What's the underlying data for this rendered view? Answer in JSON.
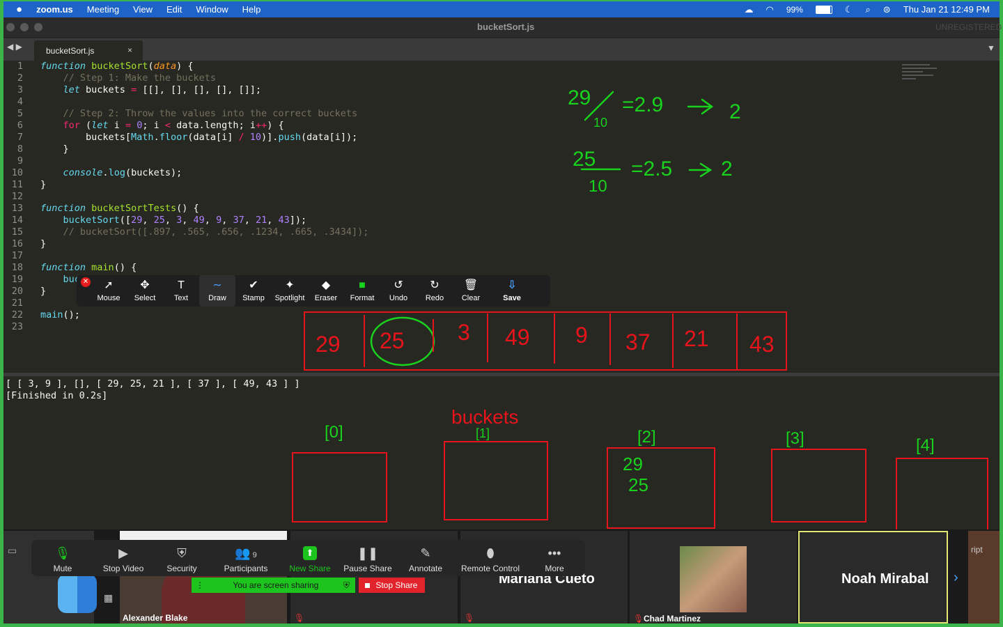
{
  "menubar": {
    "apple": "",
    "app": "zoom.us",
    "items": [
      "Meeting",
      "View",
      "Edit",
      "Window",
      "Help"
    ],
    "battery": "99%",
    "clock": "Thu Jan 21  12:49 PM"
  },
  "editor": {
    "title": "bucketSort.js",
    "status": "UNREGISTERED",
    "tab_label": "bucketSort.js",
    "tab_close": "×"
  },
  "code": [
    {
      "n": "1",
      "html": "<span class=\"kw\">function</span> <span class=\"fn\">bucketSort</span>(<span class=\"param\">data</span>) {"
    },
    {
      "n": "2",
      "html": "    <span class=\"cm\">// Step 1: Make the buckets</span>"
    },
    {
      "n": "3",
      "html": "    <span class=\"kw\">let</span> buckets <span class=\"op\">=</span> [[], [], [], [], []];"
    },
    {
      "n": "4",
      "html": ""
    },
    {
      "n": "5",
      "html": "    <span class=\"cm\">// Step 2: Throw the values into the correct buckets</span>"
    },
    {
      "n": "6",
      "html": "    <span class=\"op\">for</span> (<span class=\"kw\">let</span> i <span class=\"op\">=</span> <span class=\"num\">0</span>; i <span class=\"op\">&lt;</span> data.length; i<span class=\"op\">++</span>) {"
    },
    {
      "n": "7",
      "html": "        buckets[<span class=\"kw\" style=\"font-style:normal\">Math</span>.<span class=\"kw\" style=\"font-style:normal\">floor</span>(data[i] <span class=\"op\">/</span> <span class=\"num\">10</span>)].<span class=\"kw\" style=\"font-style:normal\">push</span>(data[i]);"
    },
    {
      "n": "8",
      "html": "    }"
    },
    {
      "n": "9",
      "html": ""
    },
    {
      "n": "10",
      "html": "    <span class=\"kw\">console</span>.<span class=\"kw\" style=\"font-style:normal\">log</span>(buckets);"
    },
    {
      "n": "11",
      "html": "}"
    },
    {
      "n": "12",
      "html": ""
    },
    {
      "n": "13",
      "html": "<span class=\"kw\">function</span> <span class=\"fn\">bucketSortTests</span>() {"
    },
    {
      "n": "14",
      "html": "    <span class=\"kw\" style=\"font-style:normal\">bucketSort</span>([<span class=\"num\">29</span>, <span class=\"num\">25</span>, <span class=\"num\">3</span>, <span class=\"num\">49</span>, <span class=\"num\">9</span>, <span class=\"num\">37</span>, <span class=\"num\">21</span>, <span class=\"num\">43</span>]);"
    },
    {
      "n": "15",
      "html": "    <span class=\"cm\">// bucketSort([.897, .565, .656, .1234, .665, .3434]);</span>"
    },
    {
      "n": "16",
      "html": "}"
    },
    {
      "n": "17",
      "html": ""
    },
    {
      "n": "18",
      "html": "<span class=\"kw\">function</span> <span class=\"fn\">main</span>() {"
    },
    {
      "n": "19",
      "html": "    <span class=\"kw\" style=\"font-style:normal\">buc</span>"
    },
    {
      "n": "20",
      "html": "}"
    },
    {
      "n": "21",
      "html": ""
    },
    {
      "n": "22",
      "html": "<span class=\"kw\" style=\"font-style:normal\">main</span>();"
    },
    {
      "n": "23",
      "html": ""
    }
  ],
  "output": {
    "line1": "[ [ 3, 9 ], [], [ 29, 25, 21 ], [ 37 ], [ 49, 43 ] ]",
    "line2": "[Finished in 0.2s]"
  },
  "annotation_toolbar": {
    "tools": [
      {
        "label": "Mouse",
        "icon": "cursor-icon",
        "glyph": "➚"
      },
      {
        "label": "Select",
        "icon": "move-icon",
        "glyph": "✥"
      },
      {
        "label": "Text",
        "icon": "text-icon",
        "glyph": "T"
      },
      {
        "label": "Draw",
        "icon": "draw-icon",
        "glyph": "∼"
      },
      {
        "label": "Stamp",
        "icon": "checkmark-icon",
        "glyph": "✔"
      },
      {
        "label": "Spotlight",
        "icon": "spotlight-icon",
        "glyph": "✦"
      },
      {
        "label": "Eraser",
        "icon": "eraser-icon",
        "glyph": "◆"
      },
      {
        "label": "Format",
        "icon": "format-icon",
        "glyph": "■"
      },
      {
        "label": "Undo",
        "icon": "undo-icon",
        "glyph": "↺"
      },
      {
        "label": "Redo",
        "icon": "redo-icon",
        "glyph": "↻"
      },
      {
        "label": "Clear",
        "icon": "trash-icon",
        "glyph": "🗑"
      },
      {
        "label": "Save",
        "icon": "save-icon",
        "glyph": "⇩"
      }
    ]
  },
  "annotations": {
    "calc1": {
      "num": "29",
      "den": "10",
      "result": "=2.9",
      "bucket": "2"
    },
    "calc2": {
      "num": "25",
      "den": "10",
      "result": "=2.5",
      "bucket": "2"
    },
    "array_values": [
      "29",
      "25",
      "3",
      "49",
      "9",
      "37",
      "21",
      "43"
    ],
    "buckets_label": "buckets",
    "bucket_labels": [
      "[0]",
      "[1]",
      "[2]",
      "[3]",
      "[4]"
    ],
    "bucket2_contents": [
      "29",
      "25"
    ]
  },
  "zoom_toolbar": {
    "buttons": [
      {
        "label": "Mute",
        "icon": "microphone-icon",
        "glyph": "🎙"
      },
      {
        "label": "Stop Video",
        "icon": "camera-icon",
        "glyph": "▶"
      },
      {
        "label": "Security",
        "icon": "shield-icon",
        "glyph": "⛨"
      },
      {
        "label": "Participants",
        "icon": "participants-icon",
        "glyph": "👥"
      },
      {
        "label": "New Share",
        "icon": "share-icon",
        "glyph": "⬆"
      },
      {
        "label": "Pause Share",
        "icon": "pause-icon",
        "glyph": "❚❚"
      },
      {
        "label": "Annotate",
        "icon": "pencil-icon",
        "glyph": "✎"
      },
      {
        "label": "Remote Control",
        "icon": "mouse-icon",
        "glyph": "⬮"
      },
      {
        "label": "More",
        "icon": "more-icon",
        "glyph": "•••"
      }
    ],
    "participants_count": "9",
    "sharing_status": "You are screen sharing",
    "stop_share": "Stop Share"
  },
  "participants": {
    "tile1_name": "Alexander Blake",
    "tile2_name": "Mariana Cueto",
    "tile3_name": "Chad Martinez",
    "tile4_name": "Noah Mirabal",
    "partial_text": "ript"
  },
  "colors": {
    "zoom_border": "#3bb54a",
    "menubar": "#1e64c8",
    "annotation_red": "#e8141c",
    "annotation_green": "#19d21e"
  }
}
